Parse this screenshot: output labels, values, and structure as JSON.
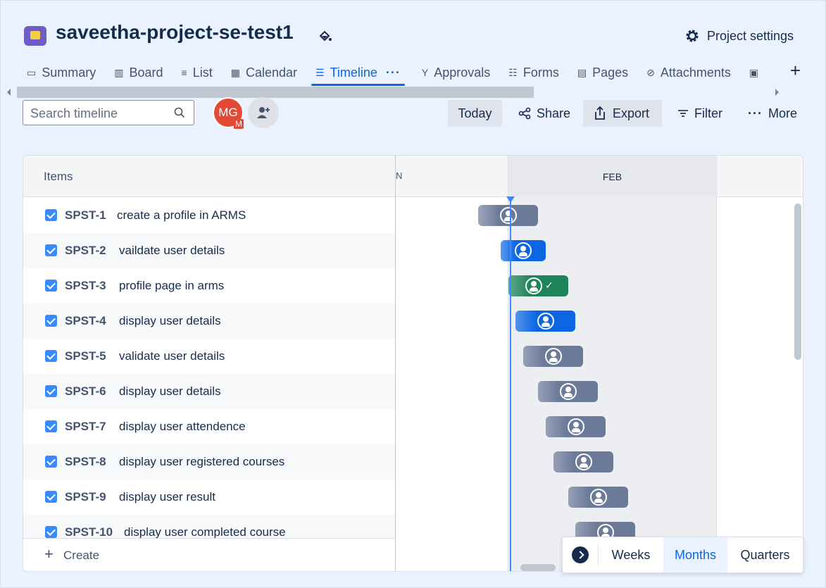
{
  "project": {
    "title": "saveetha-project-se-test1",
    "settings_label": "Project settings"
  },
  "tabs": [
    {
      "label": "Summary",
      "icon": "summary-icon"
    },
    {
      "label": "Board",
      "icon": "board-icon"
    },
    {
      "label": "List",
      "icon": "list-icon"
    },
    {
      "label": "Calendar",
      "icon": "calendar-icon"
    },
    {
      "label": "Timeline",
      "icon": "timeline-icon",
      "active": true
    },
    {
      "label": "Approvals",
      "icon": "approvals-icon"
    },
    {
      "label": "Forms",
      "icon": "forms-icon"
    },
    {
      "label": "Pages",
      "icon": "pages-icon"
    },
    {
      "label": "Attachments",
      "icon": "attachments-icon"
    }
  ],
  "toolbar": {
    "search_placeholder": "Search timeline",
    "avatar_initials": "MG",
    "avatar_sub": "M",
    "today": "Today",
    "share": "Share",
    "export": "Export",
    "filter": "Filter",
    "more": "More"
  },
  "timeline": {
    "items_header": "Items",
    "prev_month_partial": "N",
    "month": "FEB",
    "create_label": "Create"
  },
  "rows": [
    {
      "key": "SPST-1",
      "summary": "create a profile in ARMS",
      "status": "todo",
      "color": "#6b7a99"
    },
    {
      "key": "SPST-2",
      "summary": "vaildate user details",
      "status": "in-progress",
      "color": "#0c66e4"
    },
    {
      "key": "SPST-3",
      "summary": "profile page in arms",
      "status": "done",
      "color": "#1f845a"
    },
    {
      "key": "SPST-4",
      "summary": "display user details",
      "status": "in-progress",
      "color": "#0c66e4"
    },
    {
      "key": "SPST-5",
      "summary": "validate user details",
      "status": "todo",
      "color": "#6b7a99"
    },
    {
      "key": "SPST-6",
      "summary": "display user details",
      "status": "todo",
      "color": "#6b7a99"
    },
    {
      "key": "SPST-7",
      "summary": "display user attendence",
      "status": "todo",
      "color": "#6b7a99"
    },
    {
      "key": "SPST-8",
      "summary": "display user registered courses",
      "status": "todo",
      "color": "#6b7a99"
    },
    {
      "key": "SPST-9",
      "summary": "display user result",
      "status": "todo",
      "color": "#6b7a99"
    },
    {
      "key": "SPST-10",
      "summary": "display user completed course",
      "status": "todo",
      "color": "#6b7a99"
    }
  ],
  "scale": {
    "weeks": "Weeks",
    "months": "Months",
    "quarters": "Quarters",
    "selected": "Months"
  }
}
